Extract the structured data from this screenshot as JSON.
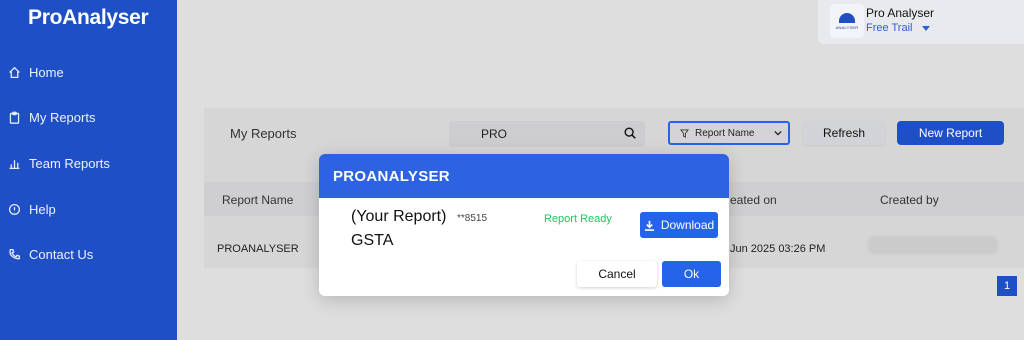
{
  "sidebar": {
    "brand": "ProAnalyser",
    "items": [
      {
        "label": "Home",
        "icon": "home-icon"
      },
      {
        "label": "My Reports",
        "icon": "clipboard-icon"
      },
      {
        "label": "Team Reports",
        "icon": "bar-chart-icon"
      },
      {
        "label": "Help",
        "icon": "help-icon"
      },
      {
        "label": "Contact Us",
        "icon": "phone-icon"
      }
    ]
  },
  "profile": {
    "logo_text": "ANALYSER",
    "name": "Pro Analyser",
    "plan": "Free Trail"
  },
  "toolbar": {
    "title": "My Reports",
    "search_value": "PRO",
    "filter_label": "Report Name",
    "refresh_label": "Refresh",
    "new_report_label": "New Report"
  },
  "table": {
    "headers": {
      "report_name": "Report Name",
      "created_on": "eated on",
      "created_by": "Created by"
    },
    "rows": [
      {
        "report_name": "PROANALYSER",
        "created_on": "Jun 2025 03:26 PM"
      }
    ]
  },
  "pagination": {
    "current": "1"
  },
  "modal": {
    "title": "PROANALYSER",
    "report_label": "(Your Report)",
    "report_suffix": "**8515",
    "report_name": "GSTA",
    "status": "Report Ready",
    "download_label": "Download",
    "cancel_label": "Cancel",
    "ok_label": "Ok"
  },
  "colors": {
    "sidebar": "#1e4fc4",
    "primary": "#2563eb",
    "modal_header": "#2d63e0",
    "status_ready": "#22c55e"
  }
}
